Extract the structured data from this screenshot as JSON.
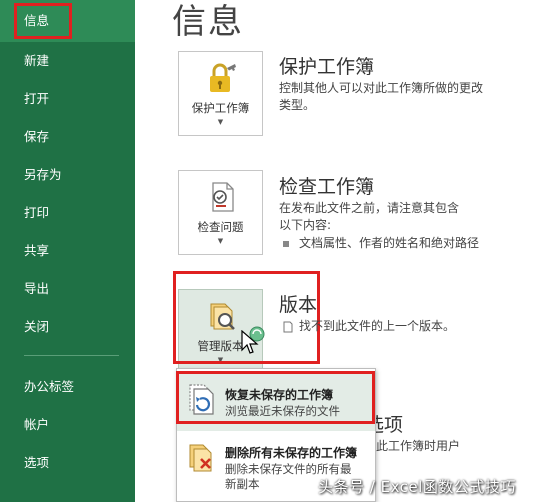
{
  "sidebar": {
    "items": [
      {
        "label": "信息",
        "key": "info"
      },
      {
        "label": "新建",
        "key": "new"
      },
      {
        "label": "打开",
        "key": "open"
      },
      {
        "label": "保存",
        "key": "save"
      },
      {
        "label": "另存为",
        "key": "save-as"
      },
      {
        "label": "打印",
        "key": "print"
      },
      {
        "label": "共享",
        "key": "share"
      },
      {
        "label": "导出",
        "key": "export"
      },
      {
        "label": "关闭",
        "key": "close"
      },
      {
        "label": "办公标签",
        "key": "office-tab"
      },
      {
        "label": "帐户",
        "key": "account"
      },
      {
        "label": "选项",
        "key": "options"
      }
    ],
    "active": "信息"
  },
  "main": {
    "title": "信息",
    "protect": {
      "button": "保护工作簿",
      "title": "保护工作簿",
      "desc_line1": "控制其他人可以对此工作簿所做的更改",
      "desc_line2": "类型。"
    },
    "inspect": {
      "button": "检查问题",
      "title": "检查工作簿",
      "desc_line1": "在发布此文件之前，请注意其包含",
      "desc_line2": "以下内容:",
      "bullet": "文档属性、作者的姓名和绝对路径"
    },
    "versions": {
      "button": "管理版本",
      "title": "版本",
      "desc": "找不到此文件的上一个版本。"
    },
    "options_partial": {
      "title": "选项",
      "desc": "此工作簿时用户"
    }
  },
  "dropdown": {
    "items": [
      {
        "title": "恢复未保存的工作簿",
        "desc": "浏览最近未保存的文件"
      },
      {
        "title": "删除所有未保存的工作簿",
        "desc_line1": "删除未保存文件的所有最",
        "desc_line2": "新副本"
      }
    ]
  },
  "watermark": "头条号 / Excel函数公式技巧",
  "colors": {
    "sidebar_bg": "#1f7145",
    "sidebar_active": "#2e8b57",
    "highlight_red": "#e02020"
  }
}
